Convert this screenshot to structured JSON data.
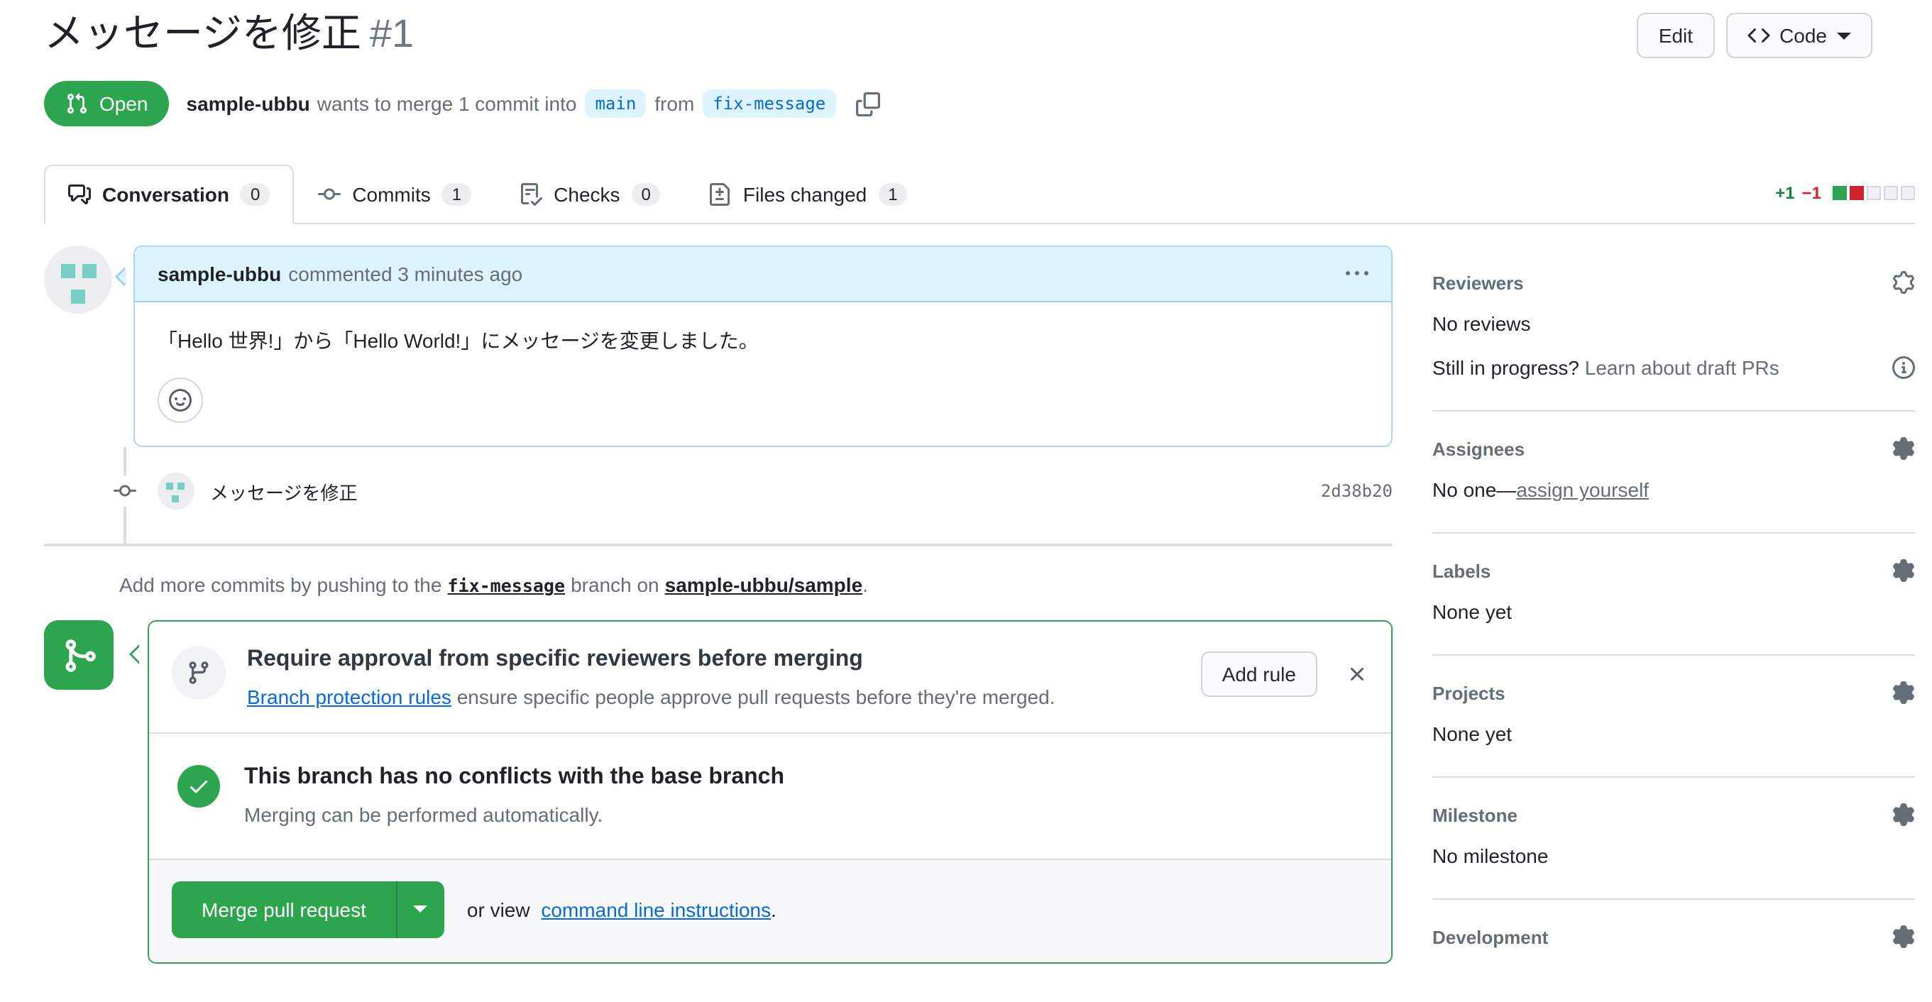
{
  "colors": {
    "open_green": "#2da44e",
    "link_blue": "#0969da",
    "added_green": "#1a7f37",
    "removed_red": "#cf222e",
    "branch_label_bg": "#ddf4ff"
  },
  "header": {
    "title": "メッセージを修正",
    "number": "#1",
    "edit_button": "Edit",
    "code_button": "Code",
    "state_badge": "Open",
    "author": "sample-ubbu",
    "summary_mid": "wants to merge 1 commit into",
    "base_branch": "main",
    "from_word": "from",
    "head_branch": "fix-message"
  },
  "tabs": {
    "conversation": {
      "label": "Conversation",
      "count": "0"
    },
    "commits": {
      "label": "Commits",
      "count": "1"
    },
    "checks": {
      "label": "Checks",
      "count": "0"
    },
    "files": {
      "label": "Files changed",
      "count": "1"
    },
    "diffstat": {
      "additions": "+1",
      "deletions": "−1"
    }
  },
  "comment": {
    "author": "sample-ubbu",
    "meta": "commented 3 minutes ago",
    "body": "「Hello 世界!」から「Hello World!」にメッセージを変更しました。"
  },
  "commit": {
    "message": "メッセージを修正",
    "sha": "2d38b20"
  },
  "push_hint": {
    "prefix": "Add more commits by pushing to the",
    "branch": "fix-message",
    "middle": "branch on",
    "repo": "sample-ubbu/sample",
    "suffix": "."
  },
  "merge_box": {
    "rule_title": "Require approval from specific reviewers before merging",
    "rule_link": "Branch protection rules",
    "rule_rest": "ensure specific people approve pull requests before they're merged.",
    "add_rule_button": "Add rule",
    "conflict_title": "This branch has no conflicts with the base branch",
    "conflict_subtitle": "Merging can be performed automatically.",
    "merge_button": "Merge pull request",
    "or_view": "or view",
    "cli_link": "command line instructions",
    "cli_suffix": "."
  },
  "sidebar": {
    "reviewers": {
      "heading": "Reviewers",
      "empty": "No reviews",
      "draft_prefix": "Still in progress?",
      "draft_link": "Learn about draft PRs"
    },
    "assignees": {
      "heading": "Assignees",
      "empty_prefix": "No one—",
      "assign_link": "assign yourself"
    },
    "labels": {
      "heading": "Labels",
      "empty": "None yet"
    },
    "projects": {
      "heading": "Projects",
      "empty": "None yet"
    },
    "milestone": {
      "heading": "Milestone",
      "empty": "No milestone"
    },
    "development": {
      "heading": "Development"
    }
  }
}
